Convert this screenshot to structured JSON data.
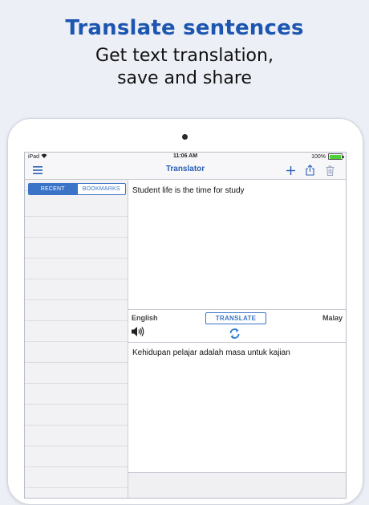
{
  "promo": {
    "title": "Translate sentences",
    "subtitle_line1": "Get text translation,",
    "subtitle_line2": "save and share"
  },
  "statusbar": {
    "device": "iPad",
    "time": "11:06 AM",
    "battery": "100%"
  },
  "navbar": {
    "title": "Translator",
    "icons": [
      "menu-icon",
      "plus-icon",
      "share-icon",
      "trash-icon"
    ]
  },
  "sidebar": {
    "tabs": [
      {
        "label": "RECENT",
        "active": true
      },
      {
        "label": "BOOKMARKS",
        "active": false
      }
    ]
  },
  "translator": {
    "source_text": "Student life is the time for study",
    "source_lang": "English",
    "target_lang": "Malay",
    "translate_label": "TRANSLATE",
    "target_text": "Kehidupan pelajar adalah masa untuk kajian"
  },
  "colors": {
    "accent": "#2a5fb3",
    "promo_title": "#1d56b0",
    "background": "#eceff6"
  }
}
